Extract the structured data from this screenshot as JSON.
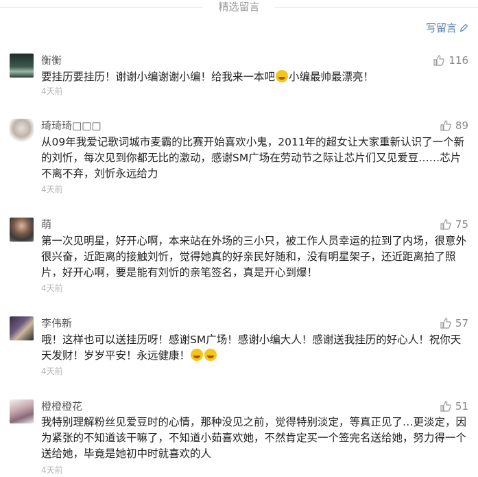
{
  "header": {
    "title": "精选留言"
  },
  "write_button": {
    "label": "写留言",
    "icon": "pencil-icon"
  },
  "comments": [
    {
      "name": "衡衡",
      "likes": "116",
      "text_a": "要挂历要挂历！谢谢小编谢谢小编！给我来一本吧",
      "text_b": "小编最帅最漂亮！",
      "time": "4天前"
    },
    {
      "name": "琦琦琦□□□",
      "likes": "89",
      "text": "从09年我爱记歌词城市麦霸的比赛开始喜欢小鬼，2011年的超女让大家重新认识了一个新的刘忻，每次见到你都无比的激动，感谢SM广场在劳动节之际让芯片们又见爱豆……芯片不离不弃，刘忻永远给力",
      "time": "4天前"
    },
    {
      "name": "萌",
      "likes": "75",
      "text": "第一次见明星，好开心啊，本来站在外场的三小只，被工作人员幸运的拉到了内场，很意外很兴奋，近距离的接触刘忻，觉得她真的好亲民好随和，没有明星架子，还近距离拍了照片，好开心啊，要是能有刘忻的亲笔签名，真是开心到爆！",
      "time": "4天前"
    },
    {
      "name": "李伟新",
      "likes": "57",
      "text": "哦！这样也可以送挂历呀！感谢SM广场！感谢小编大人！感谢送我挂历的好心人！祝你天天发财！岁岁平安！永远健康！",
      "time": "4天前"
    },
    {
      "name": "橙橙橙花",
      "likes": "51",
      "text": "我特别理解粉丝见爱豆时的心情，那种没见之前，觉得特别淡定，等真正见了…更淡定，因为紧张的不知道该干嘛了，不知道小茹喜欢她，不然肯定买一个签完名送给她，努力得一个送给她，毕竟是她初中时就喜欢的人",
      "time": "4天前"
    }
  ],
  "icons": {
    "like": "thumbs-up-icon"
  },
  "colors": {
    "link": "#5b7fa6",
    "time": "#b4b4b4",
    "emoji": "#f5c518"
  }
}
